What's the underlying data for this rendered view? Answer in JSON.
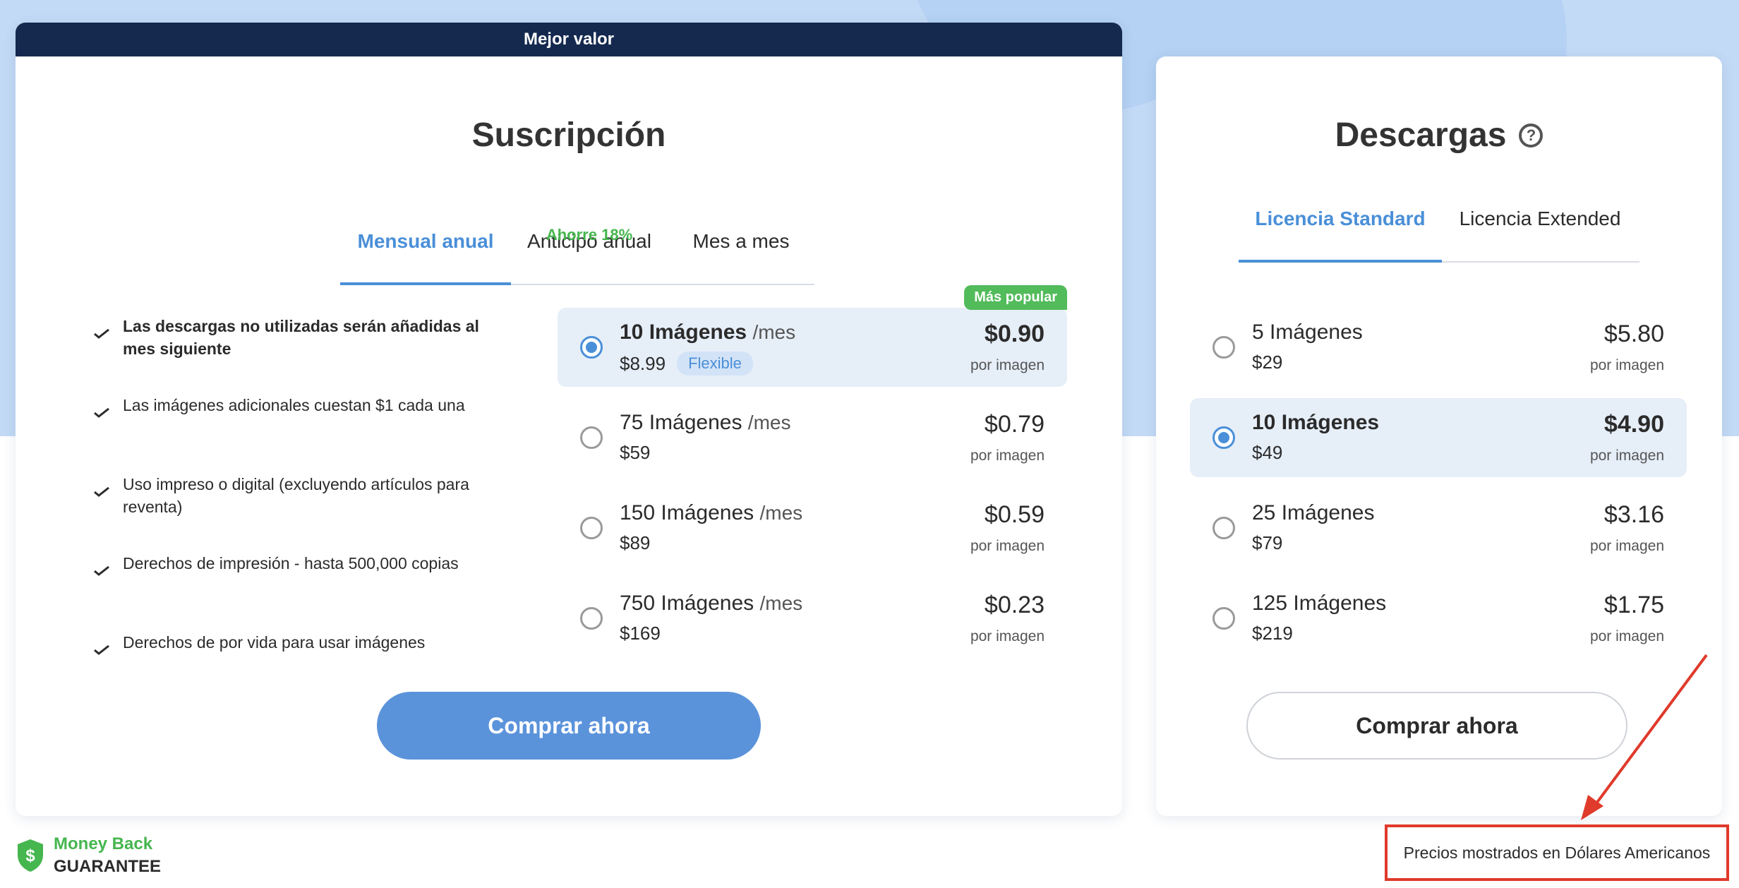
{
  "colors": {
    "accent": "#4a8fd8",
    "banner": "#15294f",
    "green": "#46b64e",
    "annotation_red": "#e03a2b",
    "button_primary": "#5b93db"
  },
  "subscription": {
    "banner": "Mejor valor",
    "title": "Suscripción",
    "tabs": [
      {
        "label": "Mensual anual",
        "badge": "",
        "active": true
      },
      {
        "label": "Anticipo anual",
        "badge": "Ahorre 18%",
        "active": false
      },
      {
        "label": "Mes a mes",
        "badge": "",
        "active": false
      }
    ],
    "features": [
      "Las descargas no utilizadas serán añadidas al mes siguiente",
      "Las imágenes adicionales cuestan $1 cada una",
      "Uso impreso o digital (excluyendo artículos para reventa)",
      "Derechos de impresión - hasta 500,000 copias",
      "Derechos de por vida para usar imágenes"
    ],
    "plans": [
      {
        "name": "10 Imágenes",
        "period": "/mes",
        "total": "$8.99",
        "tag": "Flexible",
        "price": "$0.90",
        "unit": "por imagen",
        "badge": "Más popular",
        "selected": true
      },
      {
        "name": "75 Imágenes",
        "period": "/mes",
        "total": "$59",
        "price": "$0.79",
        "unit": "por imagen",
        "selected": false
      },
      {
        "name": "150 Imágenes",
        "period": "/mes",
        "total": "$89",
        "price": "$0.59",
        "unit": "por imagen",
        "selected": false
      },
      {
        "name": "750 Imágenes",
        "period": "/mes",
        "total": "$169",
        "price": "$0.23",
        "unit": "por imagen",
        "selected": false
      }
    ],
    "buy_label": "Comprar ahora"
  },
  "downloads": {
    "title": "Descargas",
    "help_icon": "question-circle-icon",
    "tabs": [
      {
        "label": "Licencia Standard",
        "active": true
      },
      {
        "label": "Licencia Extended",
        "active": false
      }
    ],
    "plans": [
      {
        "name": "5 Imágenes",
        "total": "$29",
        "price": "$5.80",
        "unit": "por imagen",
        "selected": false
      },
      {
        "name": "10 Imágenes",
        "total": "$49",
        "price": "$4.90",
        "unit": "por imagen",
        "selected": true
      },
      {
        "name": "25 Imágenes",
        "total": "$79",
        "price": "$3.16",
        "unit": "por imagen",
        "selected": false
      },
      {
        "name": "125 Imágenes",
        "total": "$219",
        "price": "$1.75",
        "unit": "por imagen",
        "selected": false
      }
    ],
    "buy_label": "Comprar ahora"
  },
  "guarantee": {
    "line1": "Money Back",
    "line2": "GUARANTEE"
  },
  "currency_note": "Precios mostrados en Dólares Americanos"
}
